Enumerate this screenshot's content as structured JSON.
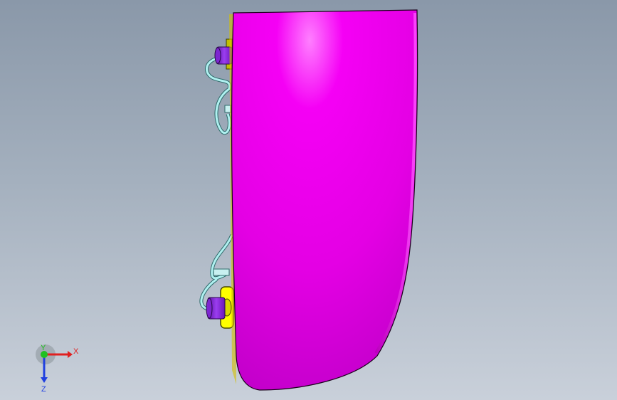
{
  "viewport": {
    "part_color": "#ff00ff",
    "hardware_color": "#8a2be2",
    "washer_color": "#ffff00",
    "hose_color": "#b0f0f0"
  },
  "triad": {
    "x_label": "X",
    "y_label": "Y",
    "z_label": "Z",
    "x_color": "#e02020",
    "y_color": "#20c020",
    "z_color": "#2040e0"
  }
}
